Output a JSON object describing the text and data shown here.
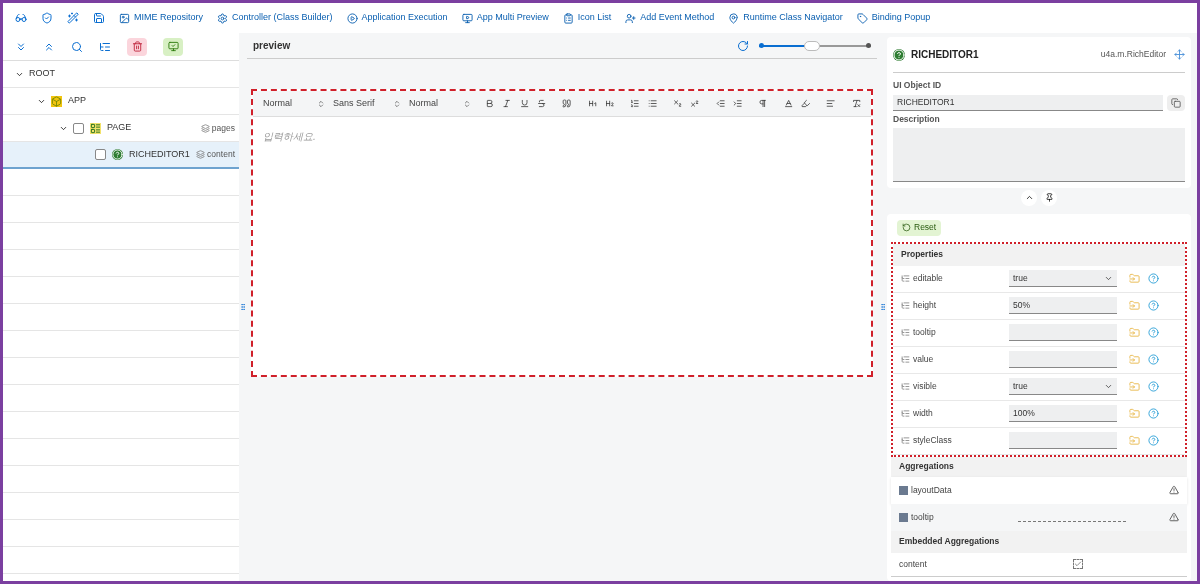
{
  "toolbar": {
    "items": [
      {
        "label": "MIME Repository"
      },
      {
        "label": "Controller (Class Builder)"
      },
      {
        "label": "Application Execution"
      },
      {
        "label": "App Multi Preview"
      },
      {
        "label": "Icon List"
      },
      {
        "label": "Add Event Method"
      },
      {
        "label": "Runtime Class Navigator"
      },
      {
        "label": "Binding Popup"
      }
    ]
  },
  "tree": {
    "items": [
      {
        "label": "ROOT",
        "expanded": true,
        "selected": false,
        "children": [
          {
            "label": "APP",
            "kind": "app",
            "expanded": true,
            "selected": false,
            "children": [
              {
                "label": "PAGE",
                "kind": "page",
                "expanded": true,
                "checked": false,
                "aggregation": "pages",
                "selected": false,
                "children": [
                  {
                    "label": "RICHEDITOR1",
                    "kind": "control",
                    "checked": false,
                    "aggregation": "content",
                    "selected": true
                  }
                ]
              }
            ]
          }
        ]
      }
    ]
  },
  "preview": {
    "title": "preview",
    "zoom": {
      "level": 0.47
    },
    "editor": {
      "selects": [
        "Normal",
        "Sans Serif",
        "Normal"
      ],
      "placeholder": "입력하세요."
    }
  },
  "inspector": {
    "title": "RICHEDITOR1",
    "class_name": "u4a.m.RichEditor",
    "id_label": "UI Object ID",
    "id_value": "RICHEDITOR1",
    "description_label": "Description",
    "reset": "Reset",
    "properties_title": "Properties",
    "properties": [
      {
        "name": "editable",
        "kind": "select",
        "value": "true"
      },
      {
        "name": "height",
        "kind": "input",
        "value": "50%"
      },
      {
        "name": "tooltip",
        "kind": "input"
      },
      {
        "name": "value",
        "kind": "input"
      },
      {
        "name": "visible",
        "kind": "select",
        "value": "true"
      },
      {
        "name": "width",
        "kind": "input",
        "value": "100%"
      },
      {
        "name": "styleClass",
        "kind": "input"
      }
    ],
    "aggregations_title": "Aggregations",
    "aggregations": [
      {
        "name": "layoutData",
        "highlighted": true,
        "binding_line": false
      },
      {
        "name": "tooltip",
        "highlighted": false,
        "binding_line": true
      }
    ],
    "embedded_title": "Embedded Aggregations",
    "embedded": [
      {
        "name": "content",
        "checked": true
      }
    ]
  }
}
